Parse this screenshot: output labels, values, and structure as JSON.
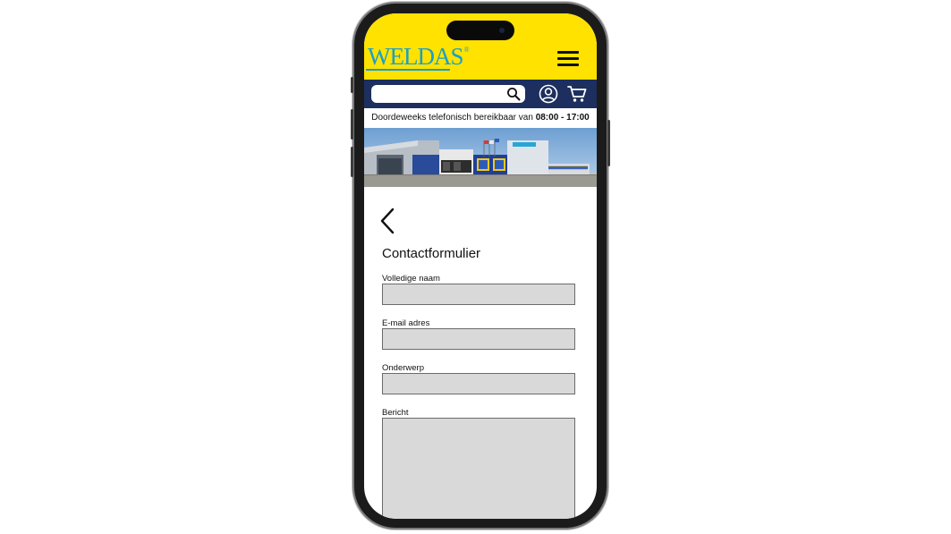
{
  "header": {
    "logo_text": "WELDAS",
    "logo_mark": "®",
    "menu_icon": "hamburger-menu-icon"
  },
  "navbar": {
    "search_value": "",
    "search_placeholder": "",
    "search_icon": "search-icon",
    "account_icon": "user-account-icon",
    "cart_icon": "shopping-cart-icon"
  },
  "info": {
    "text": "Doordeweeks telefonisch bereikbaar van ",
    "open_time": "08:00",
    "separator": " - ",
    "close_time": "17:00"
  },
  "content": {
    "back_icon": "chevron-left-icon",
    "title": "Contactformulier",
    "fields": [
      {
        "label": "Volledige naam",
        "value": ""
      },
      {
        "label": "E-mail adres",
        "value": ""
      },
      {
        "label": "Onderwerp",
        "value": ""
      },
      {
        "label": "Bericht",
        "value": ""
      }
    ]
  },
  "colors": {
    "header_yellow": "#ffe200",
    "navbar_navy": "#1c2f5e",
    "logo_blue": "#1aa0c8",
    "field_gray": "#d9d9d9"
  }
}
